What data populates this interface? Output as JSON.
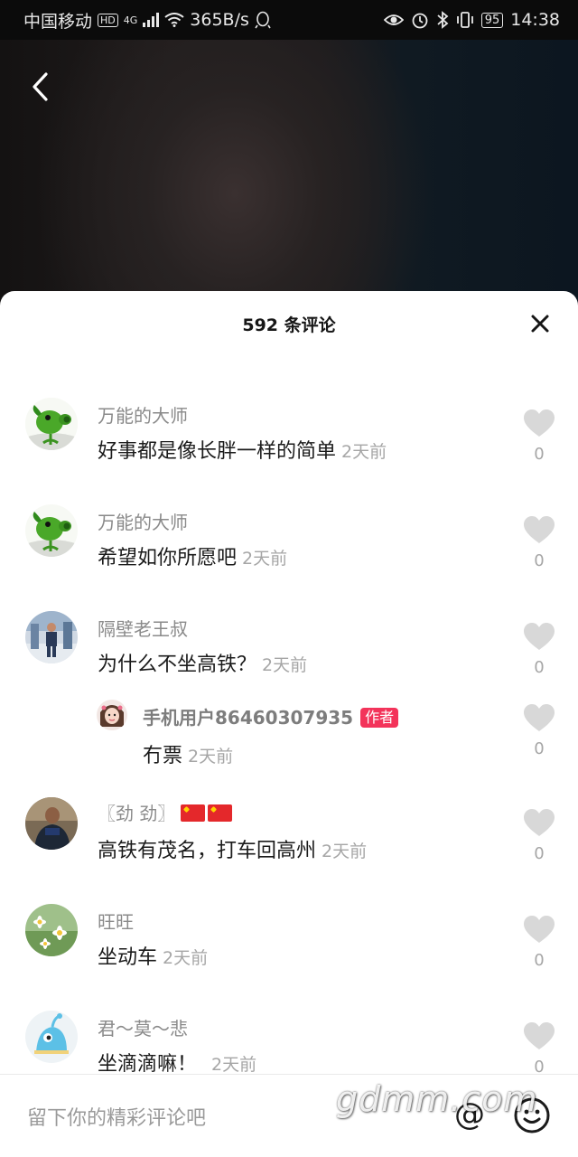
{
  "status_bar": {
    "carrier": "中国移动",
    "hd": "HD",
    "network": "4G",
    "speed": "365B/s",
    "battery": "95",
    "time": "14:38"
  },
  "sheet": {
    "title": "592 条评论"
  },
  "comments": [
    {
      "username": "万能的大师",
      "text": "好事都是像长胖一样的简单",
      "time": "2天前",
      "likes": "0",
      "avatar": "peashooter-avatar"
    },
    {
      "username": "万能的大师",
      "text": "希望如你所愿吧",
      "time": "2天前",
      "likes": "0",
      "avatar": "peashooter-avatar"
    },
    {
      "username": "隔壁老王叔",
      "text": "为什么不坐高铁？",
      "time": "2天前",
      "likes": "0",
      "avatar": "figure-avatar"
    },
    {
      "username": "手机用户86460307935",
      "badge": "作者",
      "text": "冇票",
      "time": "2天前",
      "likes": "0",
      "avatar": "girl-avatar"
    },
    {
      "username": "〖劲 劲〗",
      "text": "高铁有茂名，打车回高州",
      "time": "2天前",
      "likes": "0",
      "avatar": "man-avatar"
    },
    {
      "username": "旺旺",
      "text": "坐动车",
      "time": "2天前",
      "likes": "0",
      "avatar": "flower-avatar"
    },
    {
      "username": "君～莫～悲",
      "text": "坐滴滴嘛！",
      "time": "2天前",
      "likes": "0",
      "avatar": "cartoon-avatar"
    }
  ],
  "input_bar": {
    "placeholder": "留下你的精彩评论吧",
    "at_symbol": "@"
  },
  "watermark": "gdmm.com",
  "colors": {
    "author_badge": "#f3335a",
    "sheet_bg": "#ffffff",
    "muted_text": "#a6a6a6"
  }
}
